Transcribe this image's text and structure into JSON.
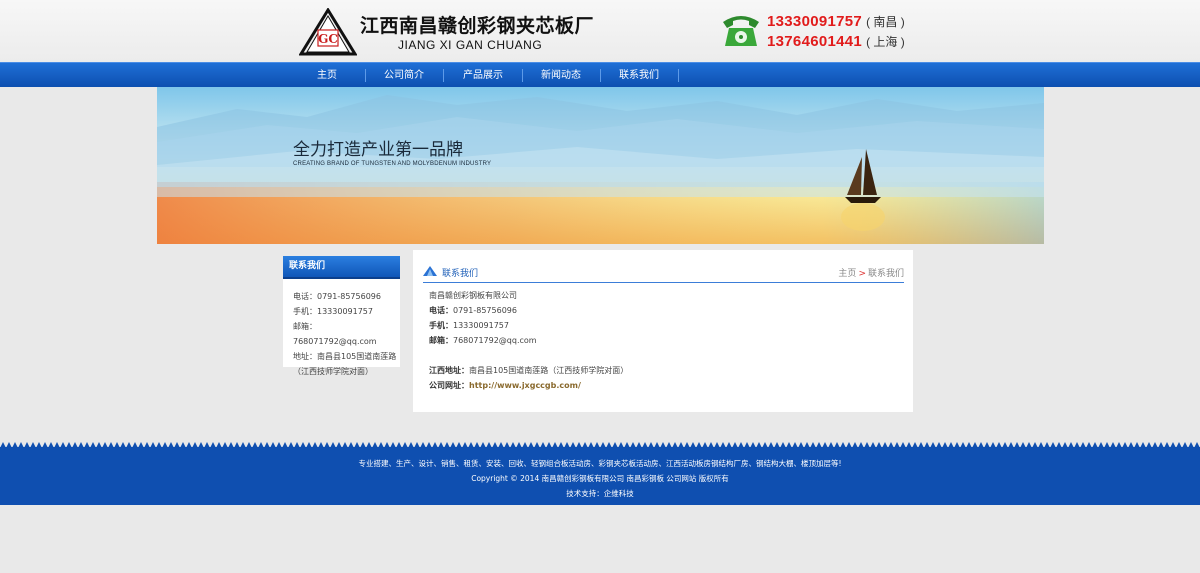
{
  "header": {
    "logo_letters": "GC",
    "company_cn": "江西南昌赣创彩钢夹芯板厂",
    "company_en": "JIANG XI GAN CHUANG",
    "phones": [
      {
        "number": "13330091757",
        "city": "( 南昌 )"
      },
      {
        "number": "13764601441",
        "city": "( 上海 )"
      }
    ]
  },
  "nav": {
    "items": [
      {
        "label": "主页"
      },
      {
        "label": "公司简介"
      },
      {
        "label": "产品展示"
      },
      {
        "label": "新闻动态"
      },
      {
        "label": "联系我们"
      }
    ]
  },
  "banner": {
    "title": "全力打造产业第一品牌",
    "subtitle": "CREATING BRAND OF TUNGSTEN AND MOLYBDENUM INDUSTRY"
  },
  "sidebar": {
    "title": "联系我们",
    "lines": [
      "电话：0791-85756096",
      "手机：13330091757",
      "邮箱：768071792@qq.com",
      "地址：南昌县105国道南莲路",
      "（江西技师学院对面）"
    ]
  },
  "content": {
    "title": "联系我们",
    "crumb_home": "主页",
    "crumb_arrow": ">",
    "crumb_current": "联系我们",
    "company": "南昌赣创彩钢板有限公司",
    "tel_label": "电话：",
    "tel": "0791-85756096",
    "mobile_label": "手机：",
    "mobile": "13330091757",
    "email_label": "邮箱：",
    "email": "768071792@qq.com",
    "address_label": "江西地址：",
    "address": "南昌县105国道南莲路（江西技师学院对面）",
    "website_label": "公司网址：",
    "website": "http://www.jxgccgb.com/"
  },
  "footer": {
    "line1": "专业搭建、生产、设计、销售、租赁、安装、回收、轻钢组合板活动房、彩钢夹芯板活动房、江西活动板房钢结构厂房、钢结构大棚、楼顶加层等!",
    "line2": "Copyright © 2014 南昌赣创彩钢板有限公司 南昌彩钢板 公司网站 版权所有",
    "line3": "技术支持：企维科技"
  },
  "colors": {
    "nav_blue": "#0d4fb0",
    "phone_red": "#e11b1b",
    "footer_blue": "#0f4fb0"
  }
}
